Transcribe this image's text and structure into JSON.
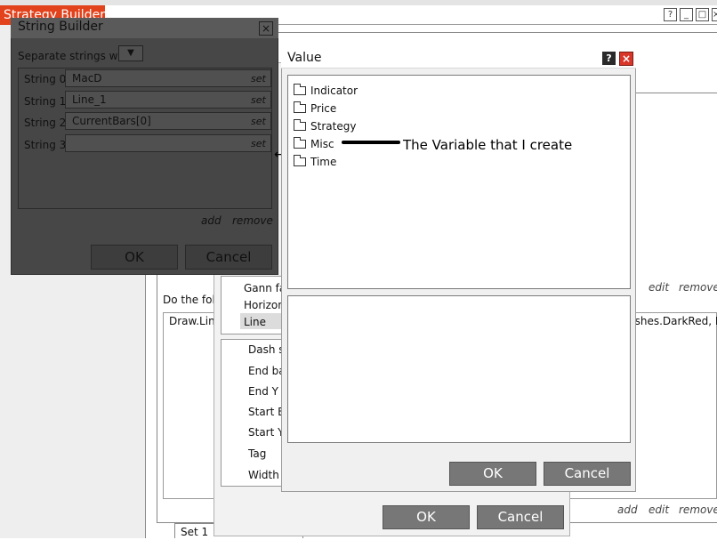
{
  "strategy_builder": {
    "title": "Strategy Builder",
    "window_buttons": [
      "?",
      "_",
      "□",
      "×"
    ],
    "do_following_label": "Do the follo",
    "action_item_text": "Draw.Line",
    "action_item_tail": "ushes.DarkRed, Da",
    "top_links": {
      "edit": "edit",
      "remove": "remove"
    },
    "bottom_links": {
      "add": "add",
      "edit": "edit",
      "remove": "remove"
    },
    "set_tab": "Set 1"
  },
  "middle_dialog": {
    "list_items": [
      "Gann fa",
      "Horizon",
      "Line"
    ],
    "properties": [
      "Dash st",
      "End ba",
      "End Y",
      "Start Ba",
      "Start Y",
      "Tag",
      "Width"
    ],
    "ok_label": "OK",
    "cancel_label": "Cancel"
  },
  "string_builder": {
    "title": "String Builder",
    "close_glyph": "×",
    "separator_label": "Separate strings with",
    "strings": [
      {
        "label": "String 0",
        "value": "MacD",
        "set": "set"
      },
      {
        "label": "String 1",
        "value": "Line_1",
        "set": "set"
      },
      {
        "label": "String 2",
        "value": "CurrentBars[0]",
        "set": "set"
      },
      {
        "label": "String 3",
        "value": "",
        "set": "set"
      }
    ],
    "add_label": "add",
    "remove_label": "remove",
    "ok_label": "OK",
    "cancel_label": "Cancel"
  },
  "value_dialog": {
    "title": "Value",
    "help_glyph": "?",
    "close_glyph": "×",
    "tree_items": [
      "Indicator",
      "Price",
      "Strategy",
      "Misc",
      "Time"
    ],
    "annotation": "The Variable that I create",
    "ok_label": "OK",
    "cancel_label": "Cancel"
  },
  "colors": {
    "title_accent": "#e2421c",
    "dark_window": "#474747",
    "button_gray": "#777777",
    "close_red": "#d9362a"
  }
}
